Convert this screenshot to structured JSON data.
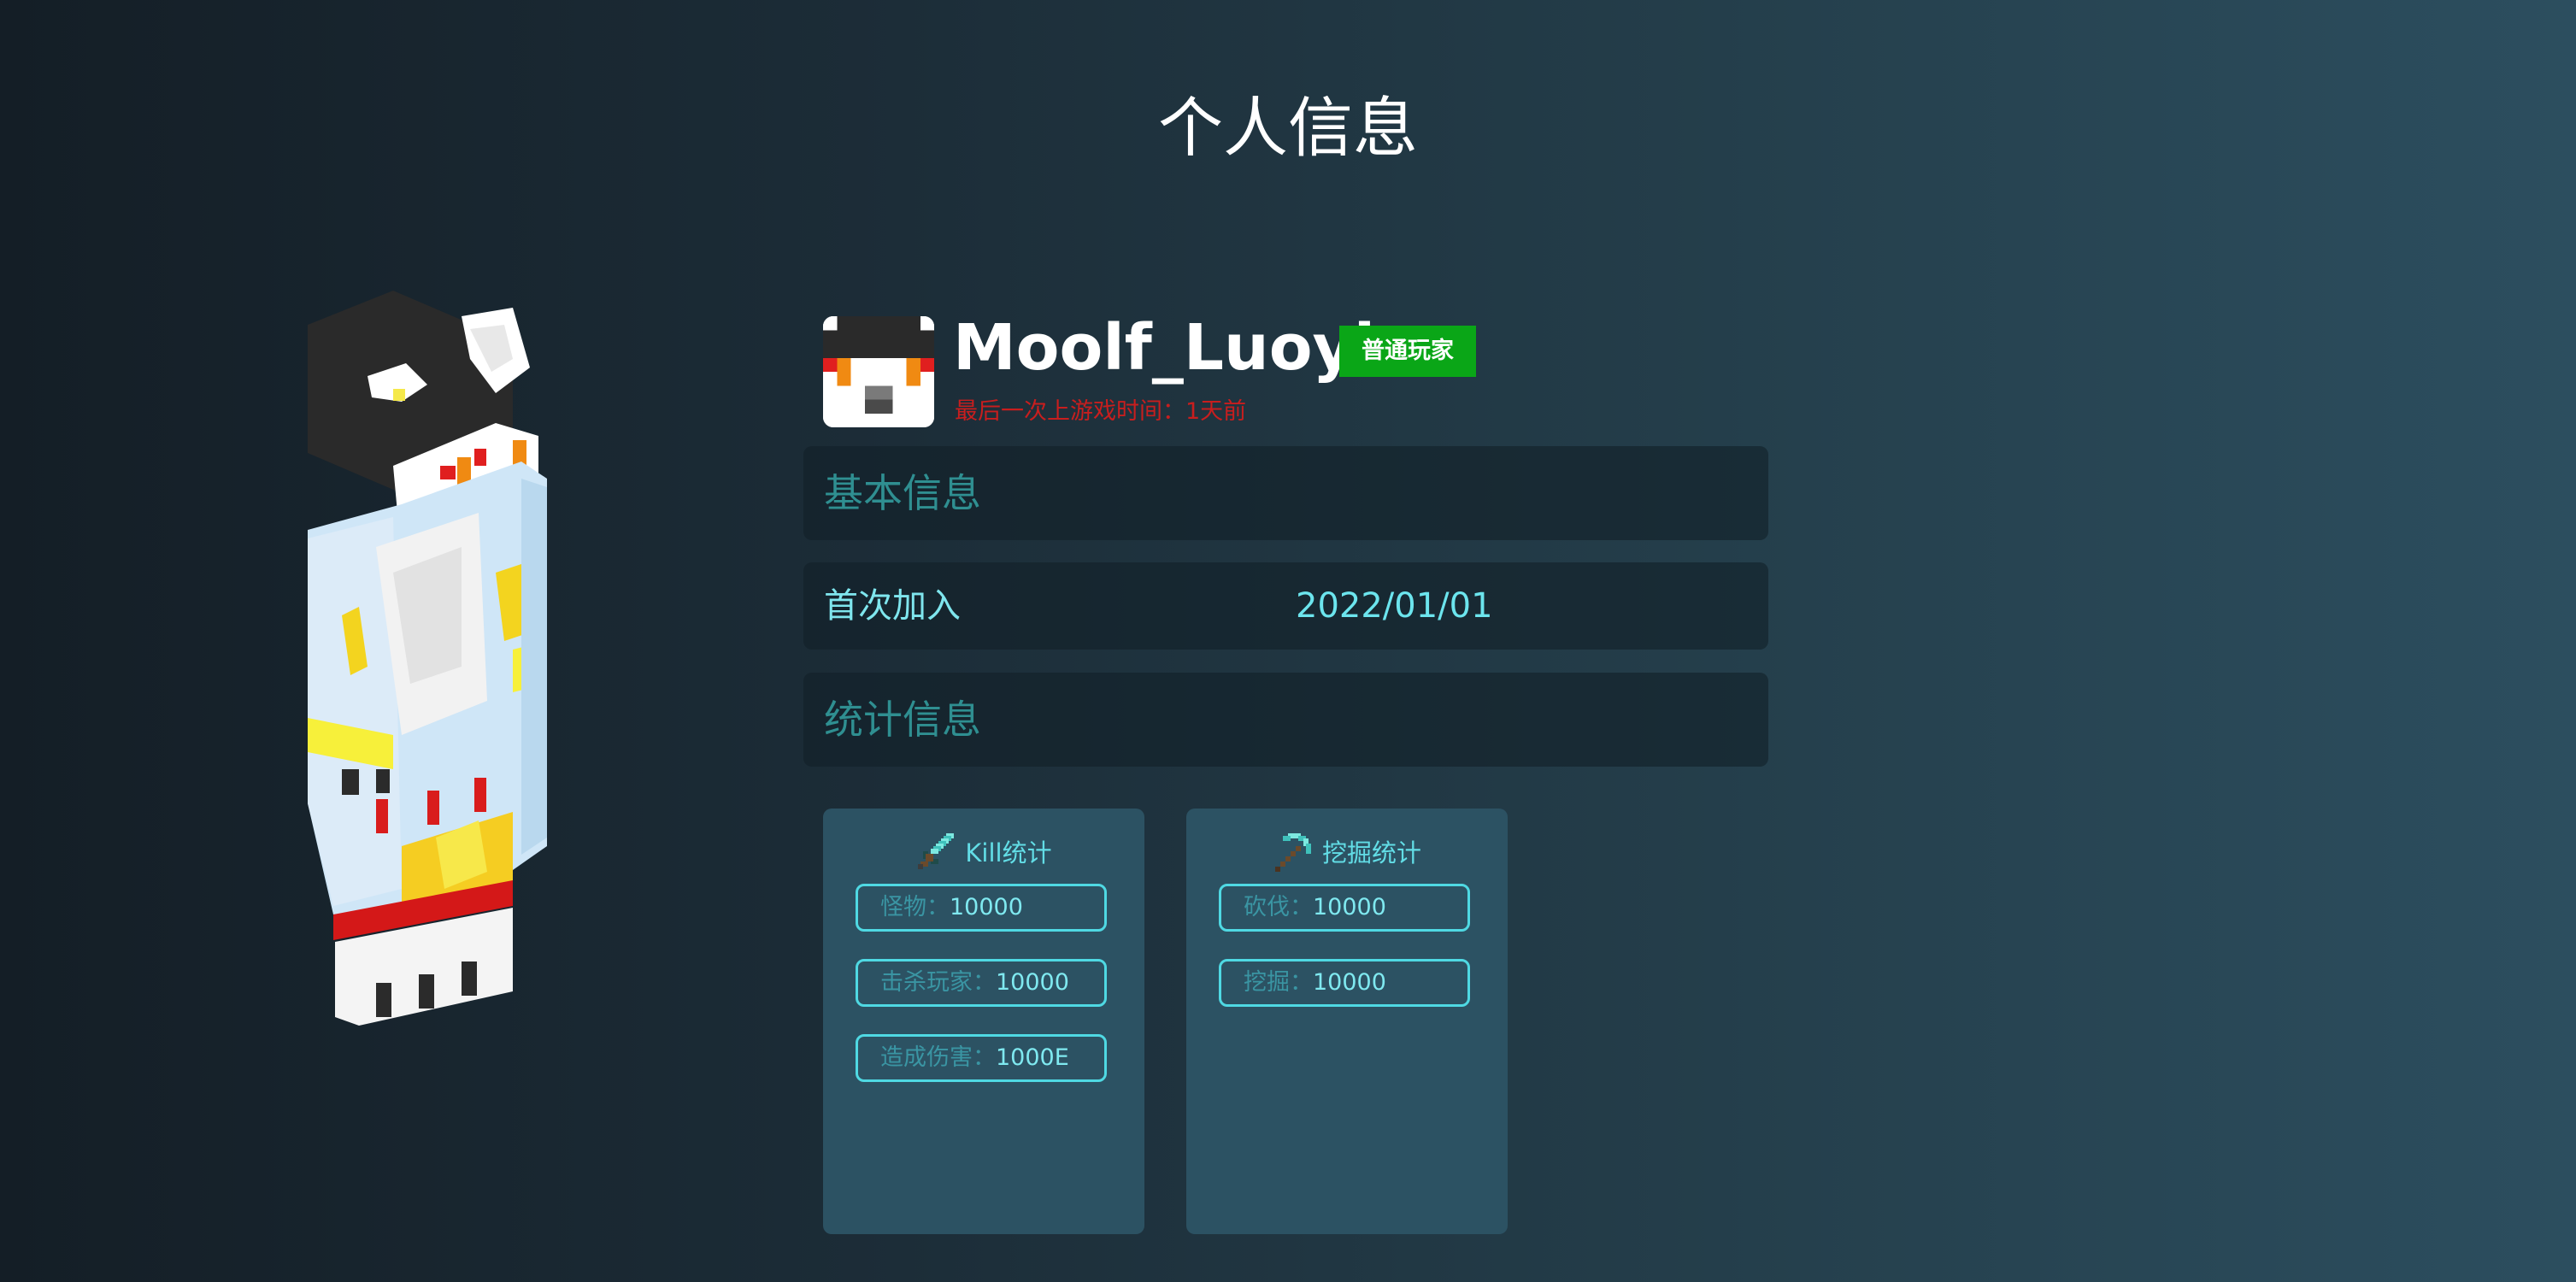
{
  "page": {
    "title": "个人信息"
  },
  "profile": {
    "username": "Moolf_Luoyi",
    "rank": "普通玩家",
    "last_seen": "最后一次上游戏时间：1天前"
  },
  "sections": {
    "basic_info": "基本信息",
    "stats_info": "统计信息"
  },
  "basic_info": {
    "first_join_label": "首次加入",
    "first_join_value": "2022/01/01"
  },
  "stat_cards": [
    {
      "title": "Kill统计",
      "icon": "diamond-sword-icon",
      "rows": [
        {
          "label": "怪物：",
          "value": "10000"
        },
        {
          "label": "击杀玩家：",
          "value": "10000"
        },
        {
          "label": "造成伤害：",
          "value": "1000E"
        }
      ]
    },
    {
      "title": "挖掘统计",
      "icon": "diamond-pickaxe-icon",
      "rows": [
        {
          "label": "砍伐：",
          "value": "10000"
        },
        {
          "label": "挖掘：",
          "value": "10000"
        }
      ]
    }
  ],
  "colors": {
    "rank_badge": "#0aa617",
    "last_seen": "#c81e1e",
    "accent": "#4fd9e3",
    "card_bg": "#2c5263"
  }
}
